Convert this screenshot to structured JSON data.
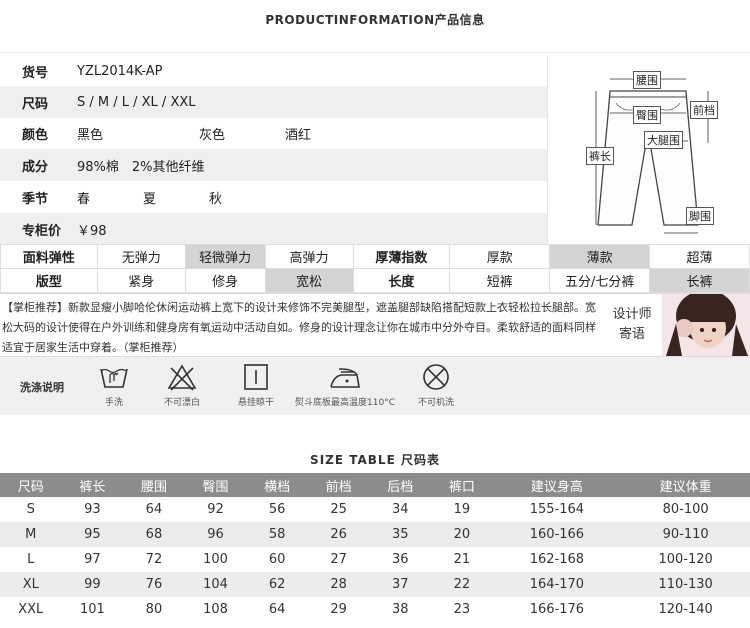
{
  "title": "PRODUCTINFORMATION产品信息",
  "info": {
    "rows": [
      {
        "label": "货号",
        "values": [
          "YZL2014K-AP"
        ]
      },
      {
        "label": "尺码",
        "values": [
          "S / M / L / XL / XXL"
        ]
      },
      {
        "label": "颜色",
        "values": [
          "黑色",
          "灰色",
          "酒红"
        ]
      },
      {
        "label": "成分",
        "values": [
          "98%棉　2%其他纤维"
        ]
      },
      {
        "label": "季节",
        "values": [
          "春",
          "夏",
          "秋"
        ]
      },
      {
        "label": "专柜价",
        "values": [
          "￥98"
        ]
      }
    ]
  },
  "diagram": {
    "waist": "腰围",
    "hip": "臀围",
    "front_rise": "前档",
    "thigh": "大腿围",
    "length": "裤长",
    "hem": "脚围"
  },
  "attributes": {
    "row1": [
      "面料弹性",
      "无弹力",
      "轻微弹力",
      "高弹力",
      "厚薄指数",
      "厚款",
      "薄款",
      "超薄"
    ],
    "row2": [
      "版型",
      "紧身",
      "修身",
      "宽松",
      "长度",
      "短裤",
      "五分/七分裤",
      "长裤"
    ]
  },
  "recommend": {
    "text": "【掌柜推荐】新款显瘦小脚哈伦休闲运动裤上宽下的设计来修饰不完美腿型，遮盖腿部缺陷搭配短款上衣轻松拉长腿部。宽松大码的设计使得在户外训练和健身房有氧运动中活动自如。修身的设计理念让你在城市中分外夺目。柔软舒适的面料同样适宜于居家生活中穿着。（掌柜推荐）",
    "side_line1": "设计师",
    "side_line2": "寄语"
  },
  "wash": {
    "label": "洗涤说明",
    "items": [
      {
        "icon": "hand-wash-icon",
        "caption": "手洗"
      },
      {
        "icon": "no-bleach-icon",
        "caption": "不可漂白"
      },
      {
        "icon": "hang-dry-icon",
        "caption": "悬挂晾干"
      },
      {
        "icon": "iron-icon",
        "caption": "熨斗底板最高温度110°C"
      },
      {
        "icon": "no-machine-wash-icon",
        "caption": "不可机洗"
      }
    ]
  },
  "size_table": {
    "title": "SIZE TABLE 尺码表",
    "headers": [
      "尺码",
      "裤长",
      "腰围",
      "臀围",
      "横档",
      "前档",
      "后档",
      "裤口",
      "建议身高",
      "建议体重"
    ],
    "rows": [
      [
        "S",
        "93",
        "64",
        "92",
        "56",
        "25",
        "34",
        "19",
        "155-164",
        "80-100"
      ],
      [
        "M",
        "95",
        "68",
        "96",
        "58",
        "26",
        "35",
        "20",
        "160-166",
        "90-110"
      ],
      [
        "L",
        "97",
        "72",
        "100",
        "60",
        "27",
        "36",
        "21",
        "162-168",
        "100-120"
      ],
      [
        "XL",
        "99",
        "76",
        "104",
        "62",
        "28",
        "37",
        "22",
        "164-170",
        "110-130"
      ],
      [
        "XXL",
        "101",
        "80",
        "108",
        "64",
        "29",
        "38",
        "23",
        "166-176",
        "120-140"
      ]
    ]
  }
}
